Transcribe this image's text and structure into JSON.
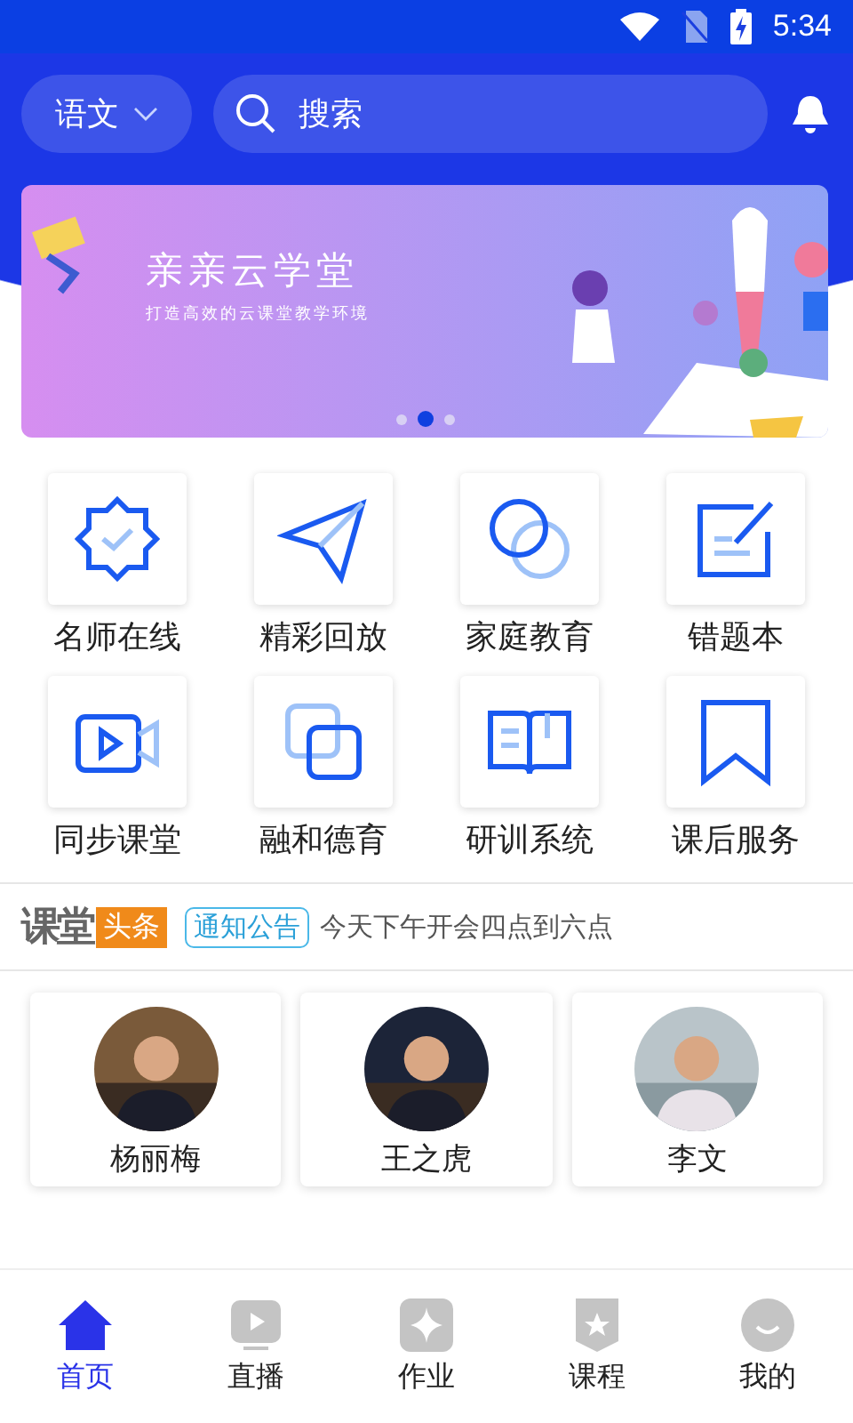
{
  "status_bar": {
    "time": "5:34"
  },
  "header": {
    "subject": "语文",
    "search": {
      "placeholder": "搜索"
    }
  },
  "banner": {
    "title": "亲亲云学堂",
    "subtitle": "打造高效的云课堂教学环境",
    "dots": [
      {
        "selected": false
      },
      {
        "selected": true
      },
      {
        "selected": false
      }
    ]
  },
  "features": [
    {
      "label": "名师在线",
      "kind": "badge"
    },
    {
      "label": "精彩回放",
      "kind": "plane"
    },
    {
      "label": "家庭教育",
      "kind": "circles"
    },
    {
      "label": "错题本",
      "kind": "edit"
    },
    {
      "label": "同步课堂",
      "kind": "video"
    },
    {
      "label": "融和德育",
      "kind": "squares"
    },
    {
      "label": "研训系统",
      "kind": "book"
    },
    {
      "label": "课后服务",
      "kind": "bookmark"
    }
  ],
  "news": {
    "logo": "课堂",
    "logo_tag": "头条",
    "tag": "通知公告",
    "text": "今天下午开会四点到六点"
  },
  "teachers": [
    {
      "name": "杨丽梅"
    },
    {
      "name": "王之虎"
    },
    {
      "name": "李文"
    }
  ],
  "tabs": [
    {
      "label": "首页",
      "kind": "home",
      "selected": true
    },
    {
      "label": "直播",
      "kind": "live",
      "selected": false
    },
    {
      "label": "作业",
      "kind": "task",
      "selected": false
    },
    {
      "label": "课程",
      "kind": "course",
      "selected": false
    },
    {
      "label": "我的",
      "kind": "me",
      "selected": false
    }
  ]
}
